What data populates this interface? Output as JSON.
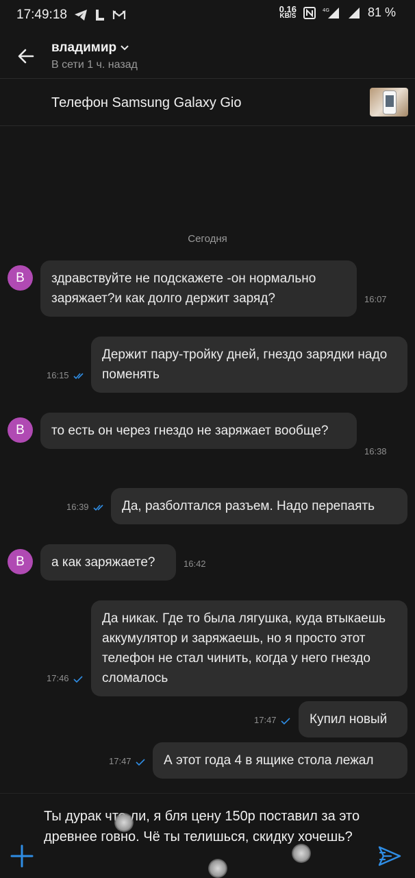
{
  "status_bar": {
    "time": "17:49:18",
    "net_speed_value": "0.16",
    "net_speed_unit": "KB/S",
    "network_type": "4G",
    "battery": "81 %"
  },
  "header": {
    "contact_name": "владимир",
    "contact_status": "В сети 1 ч. назад"
  },
  "listing": {
    "title": "Телефон Samsung Galaxy Gio"
  },
  "chat": {
    "date_separator": "Сегодня",
    "avatar_letter": "В",
    "messages": [
      {
        "direction": "in",
        "text": "здравствуйте не подскажете -он нормально заряжает?и как долго держит заряд?",
        "time": "16:07"
      },
      {
        "direction": "out",
        "text": "Держит пару-тройку дней, гнездо зарядки надо поменять",
        "time": "16:15",
        "read": true
      },
      {
        "direction": "in",
        "text": "то есть он через гнездо не заряжает вообще?",
        "time": "16:38"
      },
      {
        "direction": "out",
        "text": "Да, разболтался разъем. Надо перепаять",
        "time": "16:39",
        "read": true
      },
      {
        "direction": "in",
        "text": "а как заряжаете?",
        "time": "16:42"
      },
      {
        "direction": "out",
        "text": "Да никак. Где то была лягушка, куда втыкаешь аккумулятор и заряжаешь, но я просто этот телефон не стал чинить, когда у него гнездо сломалось",
        "time": "17:46",
        "read": true
      },
      {
        "direction": "out",
        "text": "Купил новый",
        "time": "17:47",
        "read": true
      },
      {
        "direction": "out",
        "text": "А этот года 4 в ящике стола лежал",
        "time": "17:47",
        "read": true
      }
    ]
  },
  "composer": {
    "text": "Ты дурак что-ли, я бля цену 150р поставил за это древнее говно. Чё ты телишься, скидку хочешь?"
  },
  "colors": {
    "background": "#161616",
    "bubble": "#2c2c2c",
    "avatar": "#b04ab3",
    "accent": "#2f8de4"
  }
}
